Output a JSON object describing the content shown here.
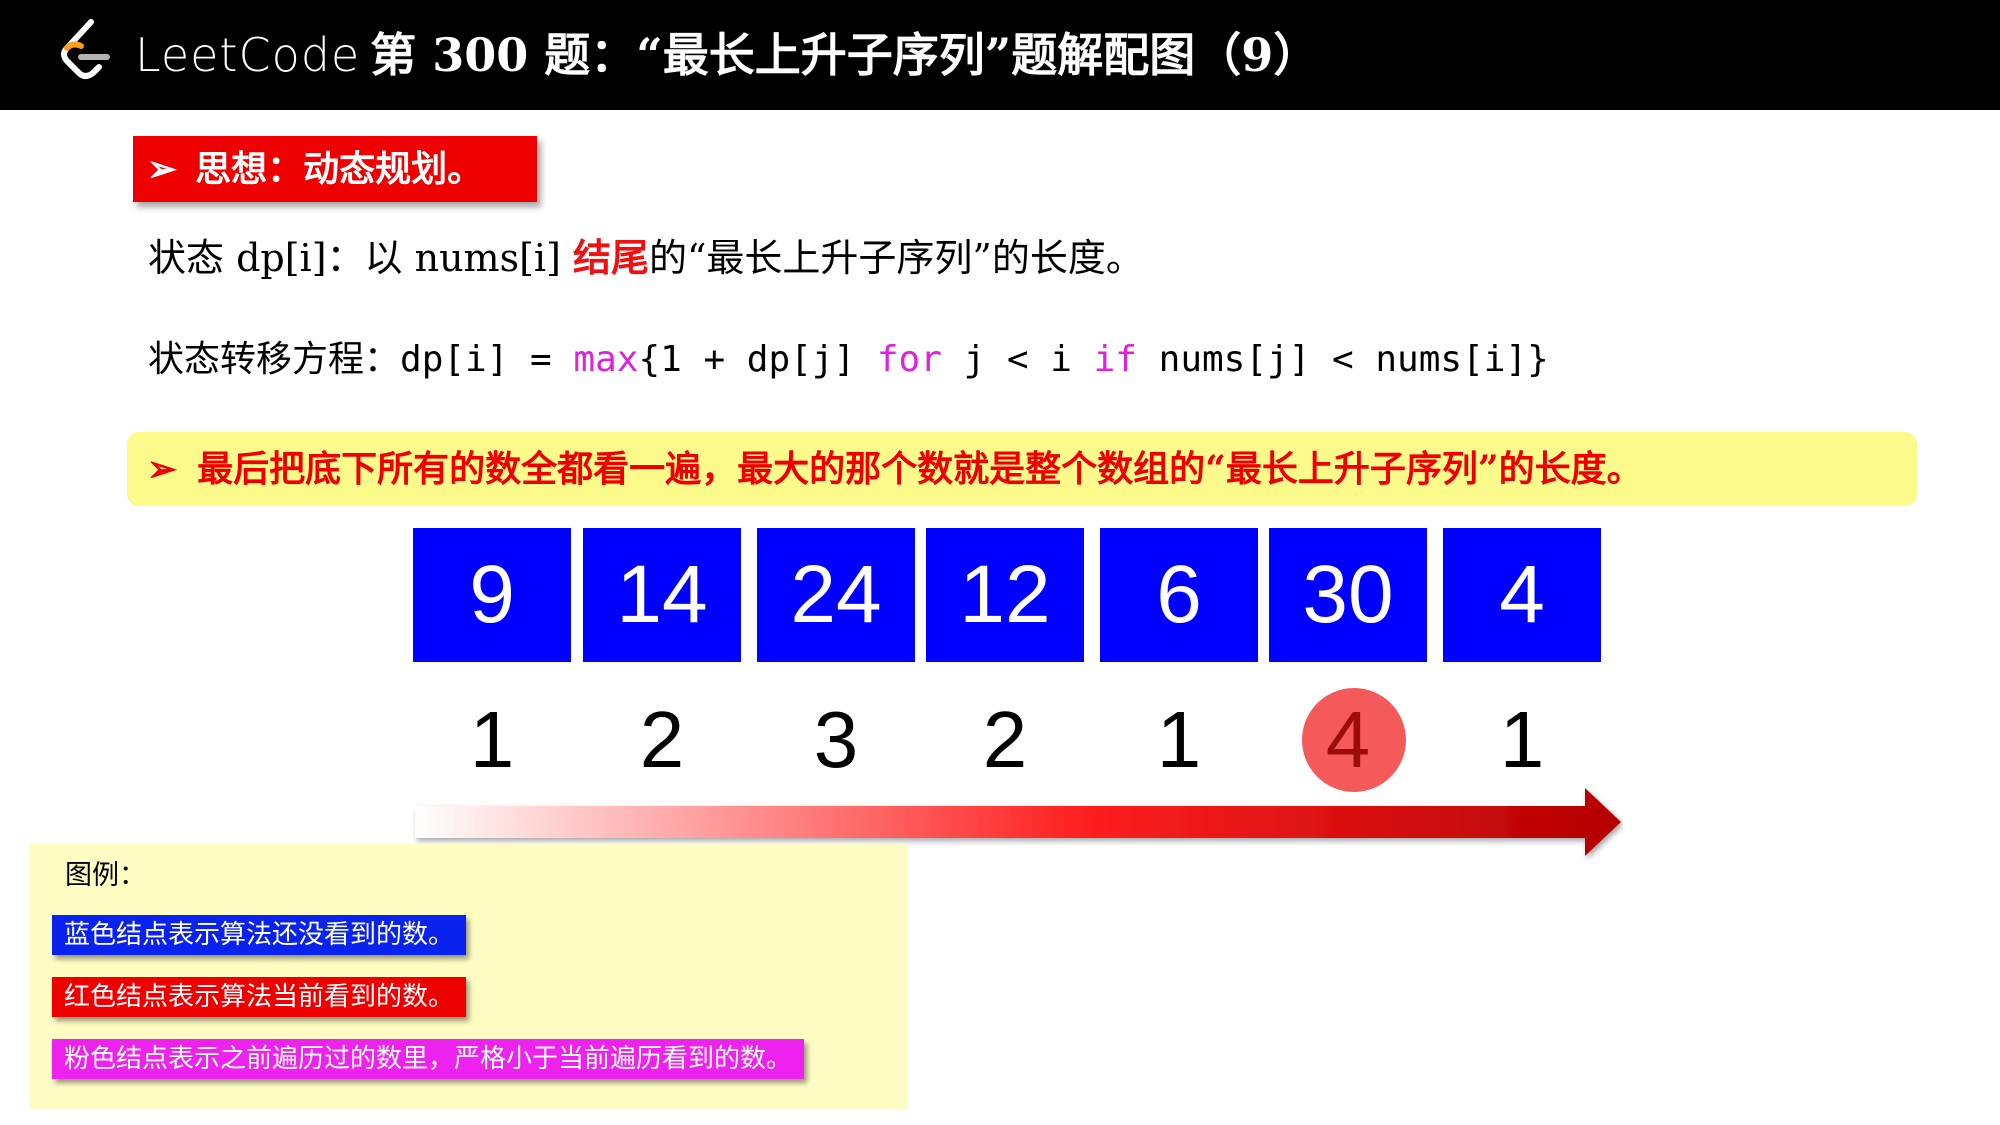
{
  "header": {
    "brand": "LeetCode",
    "title": "第 300 题：“最长上升子序列”题解配图（9）"
  },
  "idea_banner": {
    "arrow": "➢",
    "text": "思想：动态规划。"
  },
  "state_definition": {
    "part1": "状态 dp[i]：以 nums[i] ",
    "highlight": "结尾",
    "part2": "的“最长上升子序列”的长度。"
  },
  "transition": {
    "label": "状态转移方程：",
    "code_before_max": "dp[i] = ",
    "kw_max": "max",
    "code_mid1": "{1 + dp[j] ",
    "kw_for": "for",
    "code_mid2": " j < i ",
    "kw_if": "if",
    "code_end": " nums[j] < nums[i]}"
  },
  "conclusion_banner": {
    "arrow": "➢",
    "text": "最后把底下所有的数全都看一遍，最大的那个数就是整个数组的“最长上升子序列”的长度。"
  },
  "nums": [
    "9",
    "14",
    "24",
    "12",
    "6",
    "30",
    "4"
  ],
  "dp": [
    "1",
    "2",
    "3",
    "2",
    "1",
    "4",
    "1"
  ],
  "highlighted_dp_index": 5,
  "legend": {
    "title": "图例：",
    "items": [
      {
        "text": "蓝色结点表示算法还没看到的数。",
        "color": "#0a22ee"
      },
      {
        "text": "红色结点表示算法当前看到的数。",
        "color": "#ee0000"
      },
      {
        "text": "粉色结点表示之前遍历过的数里，严格小于当前遍历看到的数。",
        "color": "#ee22ee"
      }
    ]
  },
  "colors": {
    "cell_blue": "#0000ff",
    "highlight_circle": "#f45a5a",
    "highlight_text": "#9b0d0d",
    "arrow_start": "#ffffff",
    "arrow_end": "#b30000"
  }
}
